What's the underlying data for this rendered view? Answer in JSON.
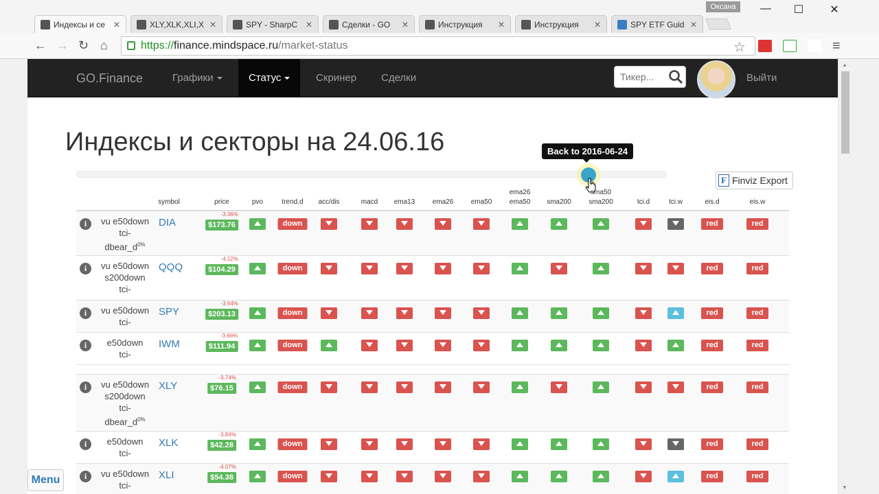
{
  "browser": {
    "tabs": [
      {
        "label": "Индексы и се",
        "favicon": "go-finance-icon"
      },
      {
        "label": "XLY,XLK,XLI,X",
        "favicon": "chart-icon"
      },
      {
        "label": "SPY - SharpC",
        "favicon": "chart-icon"
      },
      {
        "label": "Сделки - GO",
        "favicon": "go-finance-icon"
      },
      {
        "label": "Инструкция",
        "favicon": "go-finance-icon"
      },
      {
        "label": "Инструкция",
        "favicon": "go-finance-icon"
      },
      {
        "label": "SPY ETF Guid",
        "favicon": "etf-icon"
      }
    ],
    "profile_name": "Оксана",
    "url_scheme": "https://",
    "url_host": "finance.mindspace.ru",
    "url_path": "/market-status"
  },
  "nav": {
    "brand": "GO.Finance",
    "items": [
      "Графики",
      "Статус",
      "Скринер",
      "Сделки"
    ],
    "ticker_placeholder": "Тикер...",
    "logout": "Выйти"
  },
  "heading": "Индексы и секторы на 24.06.16",
  "slider": {
    "tooltip": "Back to 2016-06-24",
    "position_fraction": 0.86
  },
  "finviz_label": "Finviz Export",
  "menu_label": "Menu",
  "table": {
    "columns": [
      "symbol",
      "price",
      "pvo",
      "trend.d",
      "acc/dis",
      "macd",
      "ema13",
      "ema26",
      "ema50",
      "ema26\nema50",
      "sma200",
      "sma50\nsma200",
      "tci.d",
      "tci.w",
      "eis.d",
      "eis.w"
    ],
    "rows": [
      {
        "tags": [
          "vu e50down",
          "tci-",
          "dbear_d"
        ],
        "sup": "0%",
        "symbol": "DIA",
        "change": "-3.36%",
        "price": "$173.76",
        "signals": [
          "up-green",
          "down-text",
          "down",
          "down",
          "down",
          "down",
          "down",
          "up-green",
          "up-green",
          "up-green",
          "down",
          "down-gray",
          "red",
          "red"
        ]
      },
      {
        "tags": [
          "vu e50down",
          "s200down",
          "tci-"
        ],
        "sup": "",
        "symbol": "QQQ",
        "change": "-4.12%",
        "price": "$104.29",
        "signals": [
          "up-green",
          "down-text",
          "down",
          "down",
          "down",
          "down",
          "down",
          "up-green",
          "down",
          "up-green",
          "down",
          "down",
          "red",
          "red"
        ]
      },
      {
        "tags": [
          "vu e50down",
          "tci-"
        ],
        "sup": "",
        "symbol": "SPY",
        "change": "-3.64%",
        "price": "$203.13",
        "signals": [
          "up-green",
          "down-text",
          "down",
          "down",
          "down",
          "down",
          "down",
          "up-green",
          "up-green",
          "up-green",
          "down",
          "up-blue",
          "red",
          "red"
        ]
      },
      {
        "tags": [
          "e50down",
          "tci-"
        ],
        "sup": "",
        "symbol": "IWM",
        "change": "-3.66%",
        "price": "$111.94",
        "signals": [
          "up-green",
          "down-text",
          "up-green",
          "down",
          "down",
          "down",
          "down",
          "up-green",
          "up-green",
          "up-green",
          "down",
          "up-green",
          "red",
          "red"
        ]
      },
      {
        "tags": [
          "vu e50down",
          "s200down",
          "tci-",
          "dbear_d"
        ],
        "sup": "0%",
        "symbol": "XLY",
        "change": "-3.74%",
        "price": "$76.15",
        "signals": [
          "up-green",
          "down-text",
          "down",
          "down",
          "down",
          "down",
          "down",
          "up-green",
          "down",
          "up-green",
          "down",
          "down",
          "red",
          "red"
        ]
      },
      {
        "tags": [
          "e50down",
          "tci-"
        ],
        "sup": "",
        "symbol": "XLK",
        "change": "-3.84%",
        "price": "$42.28",
        "signals": [
          "up-green",
          "down-text",
          "down",
          "down",
          "down",
          "down",
          "down",
          "up-green",
          "up-green",
          "up-green",
          "down",
          "down-gray",
          "red",
          "red"
        ]
      },
      {
        "tags": [
          "vu e50down",
          "tci-"
        ],
        "sup": "",
        "symbol": "XLI",
        "change": "-4.07%",
        "price": "$54.38",
        "signals": [
          "up-green",
          "down-text",
          "down",
          "down",
          "down",
          "down",
          "down",
          "up-green",
          "up-green",
          "up-green",
          "down",
          "up-blue",
          "red",
          "red"
        ]
      }
    ],
    "down_label": "down",
    "red_label": "red"
  }
}
